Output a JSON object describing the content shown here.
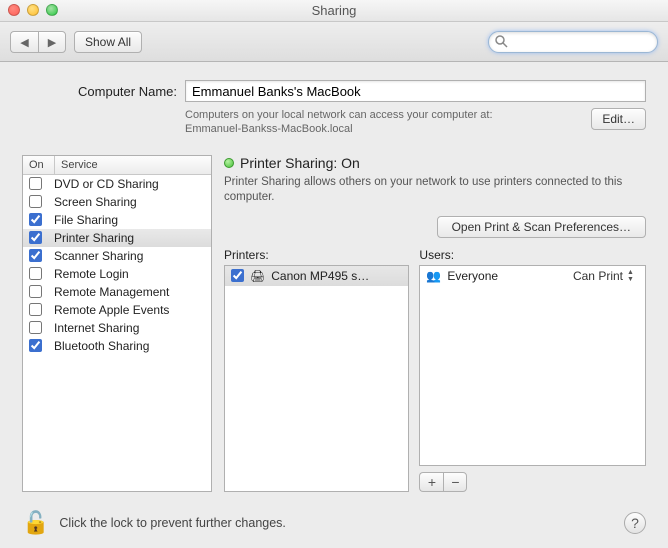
{
  "window": {
    "title": "Sharing"
  },
  "toolbar": {
    "show_all": "Show All",
    "search_placeholder": ""
  },
  "computer_name": {
    "label": "Computer Name:",
    "value": "Emmanuel Banks's MacBook",
    "hint1": "Computers on your local network can access your computer at:",
    "hint2": "Emmanuel-Bankss-MacBook.local",
    "edit": "Edit…"
  },
  "services": {
    "col_on": "On",
    "col_service": "Service",
    "items": [
      {
        "on": false,
        "label": "DVD or CD Sharing"
      },
      {
        "on": false,
        "label": "Screen Sharing"
      },
      {
        "on": true,
        "label": "File Sharing"
      },
      {
        "on": true,
        "label": "Printer Sharing",
        "selected": true
      },
      {
        "on": true,
        "label": "Scanner Sharing"
      },
      {
        "on": false,
        "label": "Remote Login"
      },
      {
        "on": false,
        "label": "Remote Management"
      },
      {
        "on": false,
        "label": "Remote Apple Events"
      },
      {
        "on": false,
        "label": "Internet Sharing"
      },
      {
        "on": true,
        "label": "Bluetooth Sharing"
      }
    ]
  },
  "detail": {
    "status_title": "Printer Sharing: On",
    "status_desc": "Printer Sharing allows others on your network to use printers connected to this computer.",
    "open_pref": "Open Print & Scan Preferences…",
    "printers_label": "Printers:",
    "users_label": "Users:",
    "printers": [
      {
        "checked": true,
        "name": "Canon MP495 s…"
      }
    ],
    "users": [
      {
        "name": "Everyone",
        "perm": "Can Print"
      }
    ],
    "add": "+",
    "remove": "−"
  },
  "footer": {
    "text": "Click the lock to prevent further changes.",
    "help": "?"
  }
}
